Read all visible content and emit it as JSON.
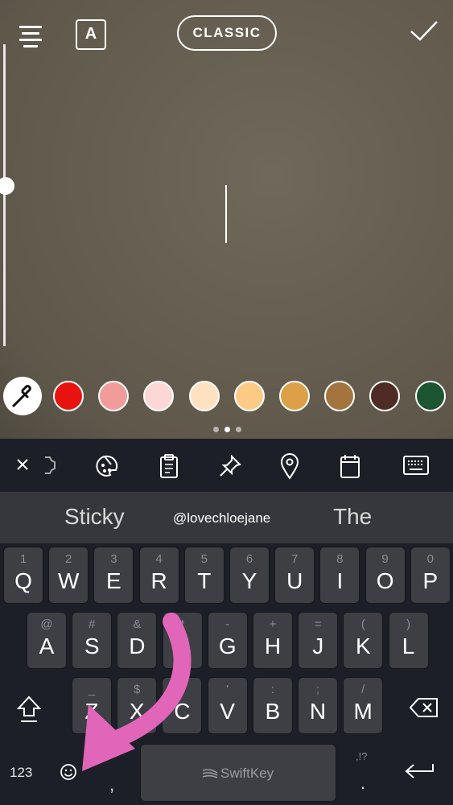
{
  "editor": {
    "mode_label": "CLASSIC",
    "font_label": "A",
    "pager": {
      "pages": 3,
      "active": 2
    },
    "text_size_level": 0.47
  },
  "palette": {
    "colors": [
      "#e8130f",
      "#f29b9b",
      "#fcd7d5",
      "#fde1c0",
      "#fdca86",
      "#dca048",
      "#a4743f",
      "#4f2b26",
      "#1d5533"
    ]
  },
  "toolbar": {
    "icons": [
      "close-icon",
      "settings-icon",
      "palette-icon",
      "clipboard-icon",
      "pin-icon",
      "location-icon",
      "calendar-icon",
      "keyboard-icon"
    ]
  },
  "suggestions": [
    "Sticky",
    "@lovechloejane",
    "The"
  ],
  "keyboard": {
    "row1": [
      {
        "k": "Q",
        "h": "1"
      },
      {
        "k": "W",
        "h": "2"
      },
      {
        "k": "E",
        "h": "3"
      },
      {
        "k": "R",
        "h": "4"
      },
      {
        "k": "T",
        "h": "5"
      },
      {
        "k": "Y",
        "h": "6"
      },
      {
        "k": "U",
        "h": "7"
      },
      {
        "k": "I",
        "h": "8"
      },
      {
        "k": "O",
        "h": "9"
      },
      {
        "k": "P",
        "h": "0"
      }
    ],
    "row2": [
      {
        "k": "A",
        "h": "@"
      },
      {
        "k": "S",
        "h": "#"
      },
      {
        "k": "D",
        "h": "&"
      },
      {
        "k": "F",
        "h": "*"
      },
      {
        "k": "G",
        "h": "-"
      },
      {
        "k": "H",
        "h": "+"
      },
      {
        "k": "J",
        "h": "="
      },
      {
        "k": "K",
        "h": "("
      },
      {
        "k": "L",
        "h": ")"
      }
    ],
    "row3": [
      {
        "k": "Z",
        "h": "_"
      },
      {
        "k": "X",
        "h": "$"
      },
      {
        "k": "C",
        "h": "\""
      },
      {
        "k": "V",
        "h": "'"
      },
      {
        "k": "B",
        "h": ":"
      },
      {
        "k": "N",
        "h": ";"
      },
      {
        "k": "M",
        "h": "/"
      }
    ],
    "numbers_label": "123",
    "comma": ",",
    "space_label": "SwiftKey",
    "period": ".",
    "punct_hint": ",!?"
  },
  "annotation": {
    "arrow_color": "#e165b8"
  }
}
